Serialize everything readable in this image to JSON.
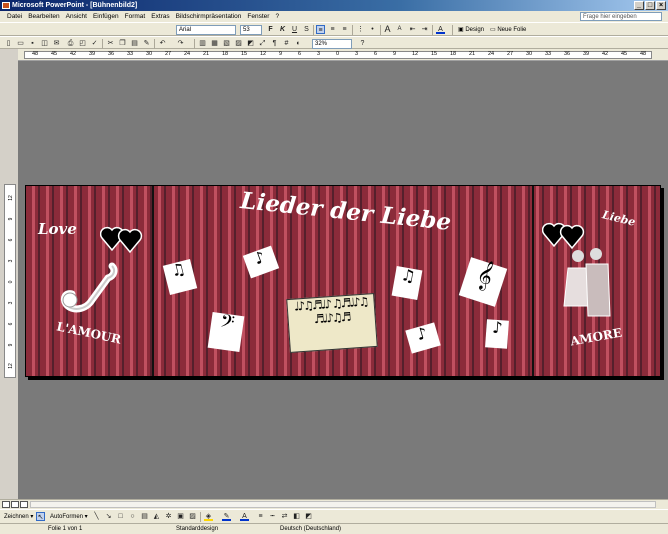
{
  "window": {
    "title": "Microsoft PowerPoint - [Bühnenbild2]"
  },
  "menu": {
    "items": [
      "Datei",
      "Bearbeiten",
      "Ansicht",
      "Einfügen",
      "Format",
      "Extras",
      "Bildschirmpräsentation",
      "Fenster",
      "?"
    ],
    "help_placeholder": "Frage hier eingeben"
  },
  "format_toolbar": {
    "font": "Arial",
    "size": "53",
    "bold": "F",
    "italic": "K",
    "underline": "U",
    "shadow": "S",
    "design_label": "Design",
    "new_slide_label": "Neue Folie"
  },
  "standard_toolbar": {
    "zoom": "32%"
  },
  "ruler": {
    "ticks": [
      "48",
      "45",
      "42",
      "39",
      "36",
      "33",
      "30",
      "27",
      "24",
      "21",
      "18",
      "15",
      "12",
      "9",
      "6",
      "3",
      "0",
      "3",
      "6",
      "9",
      "12",
      "15",
      "18",
      "21",
      "24",
      "27",
      "30",
      "33",
      "36",
      "39",
      "42",
      "45",
      "48"
    ],
    "vticks": [
      "12",
      "9",
      "6",
      "3",
      "0",
      "3",
      "6",
      "9",
      "12"
    ]
  },
  "slide": {
    "title": "Lieder der Liebe",
    "left_top": "Love",
    "left_bottom": "L'AMOUR",
    "right_top": "Liebe",
    "right_bottom": "AMORE"
  },
  "drawing_toolbar": {
    "draw_label": "Zeichnen",
    "autoshapes_label": "AutoFormen"
  },
  "status": {
    "slide": "Folie 1 von 1",
    "design": "Standarddesign",
    "language": "Deutsch (Deutschland)"
  },
  "colors": {
    "stripe_dark": "#8b2b3a",
    "stripe_light": "#c05060",
    "canvas": "#7a7a7a"
  }
}
